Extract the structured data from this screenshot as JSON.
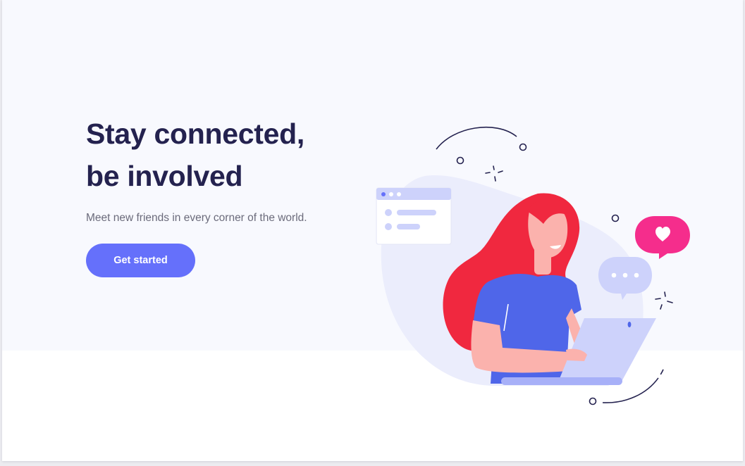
{
  "hero": {
    "headline_line1": "Stay connected,",
    "headline_line2": "be involved",
    "subtext": "Meet new friends in every corner of the world.",
    "cta_label": "Get started"
  },
  "illustration": {
    "icons": [
      "window-card-icon",
      "heart-bubble-icon",
      "typing-bubble-icon",
      "sparkle-icon",
      "laptop-icon"
    ]
  },
  "colors": {
    "background": "#f8f9fe",
    "headline": "#24224f",
    "accent": "#6570fb",
    "hair": "#f0283f",
    "shirt": "#4f66e9",
    "heart_bubble": "#f52d8c"
  }
}
